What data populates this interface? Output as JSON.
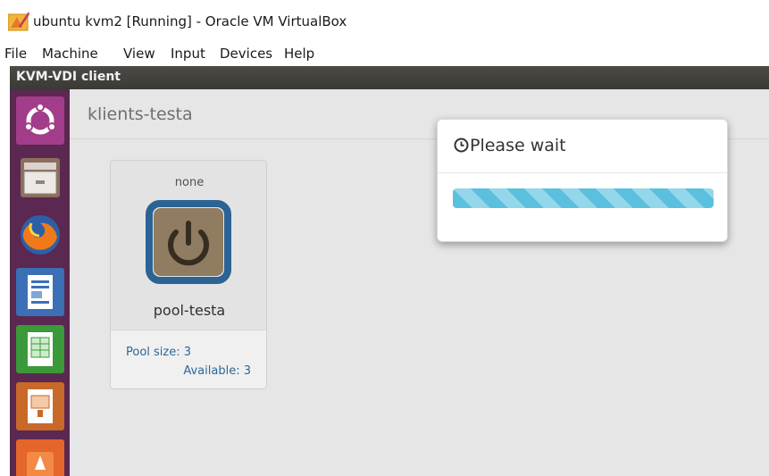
{
  "window": {
    "title": "ubuntu kvm2 [Running] - Oracle VM VirtualBox"
  },
  "menu": [
    "File",
    "Machine",
    "View",
    "Input",
    "Devices",
    "Help"
  ],
  "guest": {
    "title": "KVM-VDI client",
    "launcher": [
      {
        "name": "ubuntu-dash-icon"
      },
      {
        "name": "files-icon"
      },
      {
        "name": "firefox-icon"
      },
      {
        "name": "libreoffice-writer-icon"
      },
      {
        "name": "libreoffice-calc-icon"
      },
      {
        "name": "libreoffice-impress-icon"
      },
      {
        "name": "software-center-icon"
      }
    ]
  },
  "page": {
    "title": "klients-testa",
    "pool": {
      "state": "none",
      "name": "pool-testa",
      "size": "Pool size: 3",
      "available": "Available: 3"
    }
  },
  "modal": {
    "title": "Please wait",
    "icon": "clock-icon",
    "progress": 100
  },
  "colors": {
    "launcher": "#5a2850",
    "power_button": "#2e6a9e",
    "progress": "#5bc0de",
    "link": "#2f6fa5"
  }
}
